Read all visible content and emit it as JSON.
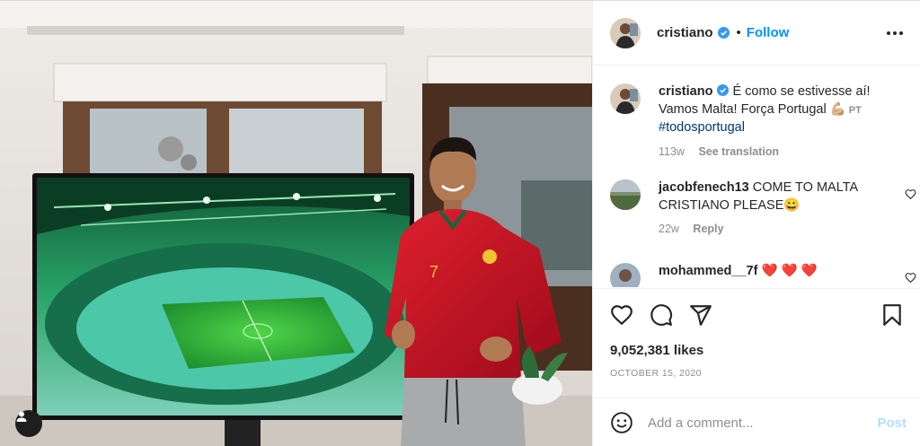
{
  "post": {
    "username": "cristiano",
    "follow_label": "Follow",
    "separator": "•"
  },
  "caption": {
    "username": "cristiano",
    "text": "É como se estivesse aí! Vamos Malta! Força Portugal 💪🏼",
    "lang": "PT",
    "hashtag": "#todosportugal",
    "age": "113w",
    "see_translation": "See translation"
  },
  "comments": [
    {
      "username": "jacobfenech13",
      "text": "COME TO MALTA CRISTIANO PLEASE😀",
      "age": "22w",
      "reply_label": "Reply"
    },
    {
      "username": "mohammed__7f",
      "text": "❤️ ❤️ ❤️"
    }
  ],
  "likes": "9,052,381 likes",
  "date": "OCTOBER 15, 2020",
  "add_comment": {
    "placeholder": "Add a comment...",
    "post_label": "Post"
  },
  "colors": {
    "accent": "#0095f6",
    "post_disabled": "#b2dffc",
    "secondary_text": "#8e8e8e",
    "hashtag": "#00376b",
    "jersey_red": "#c8102e",
    "stadium_green": "#3cb34a"
  },
  "icons": [
    "verified-badge-icon",
    "more-options-icon",
    "heart-icon",
    "comment-icon",
    "share-icon",
    "bookmark-icon",
    "emoji-icon",
    "user-tag-icon"
  ]
}
